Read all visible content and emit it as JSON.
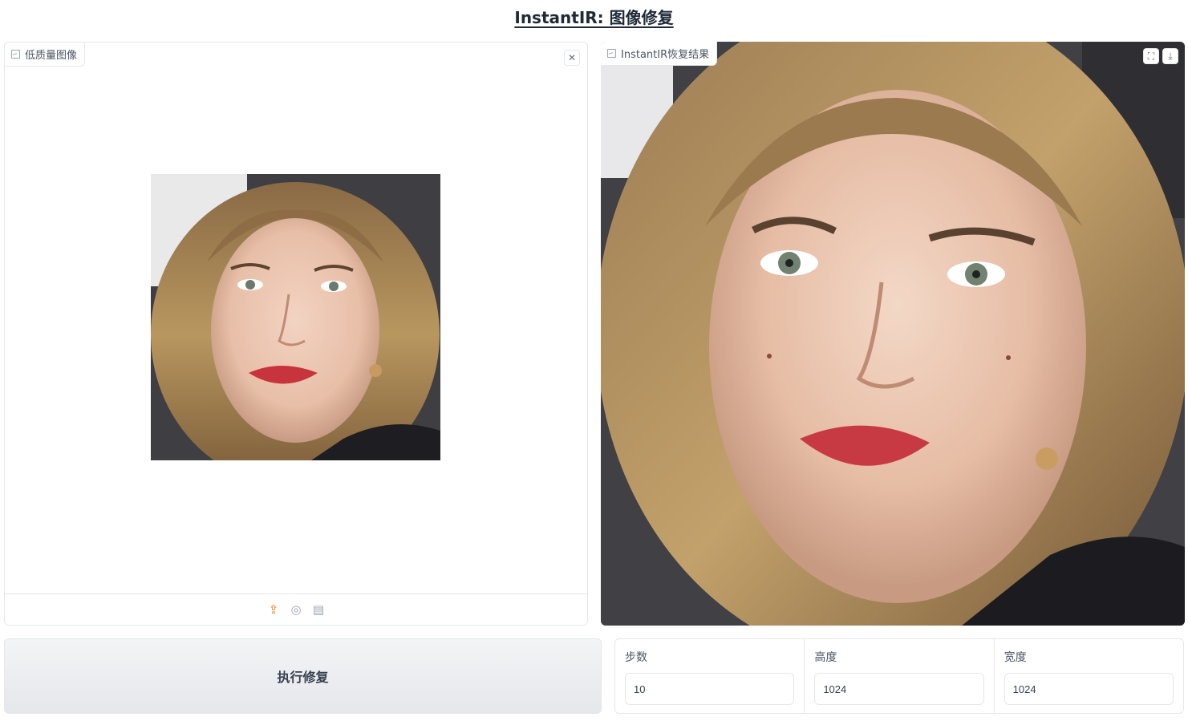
{
  "header": {
    "title": "InstantIR: 图像修复"
  },
  "input_panel": {
    "label": "低质量图像",
    "close_icon": "close-icon",
    "toolbar": {
      "icons": [
        "upload-icon",
        "webcam-icon",
        "clipboard-icon"
      ]
    }
  },
  "output_panel": {
    "label": "InstantIR恢复结果",
    "icons": [
      "fullscreen-icon",
      "download-icon"
    ]
  },
  "run_button": {
    "label": "执行修复"
  },
  "params": {
    "steps": {
      "label": "步数",
      "value": "10"
    },
    "height": {
      "label": "高度",
      "value": "1024"
    },
    "width": {
      "label": "宽度",
      "value": "1024"
    }
  },
  "colors": {
    "accent": "#f97316",
    "border": "#e5e7eb",
    "text": "#374151"
  }
}
